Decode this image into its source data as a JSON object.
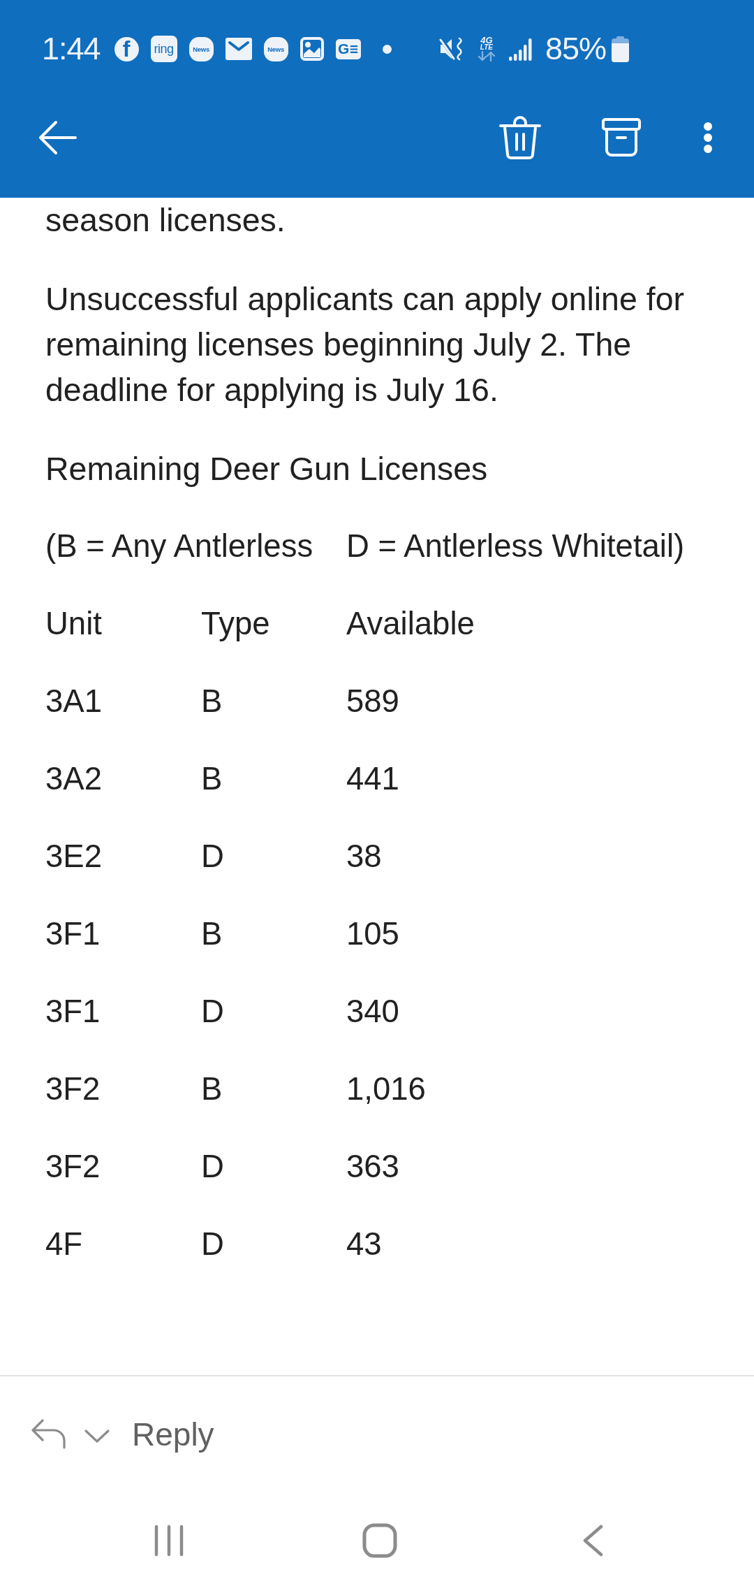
{
  "status_bar": {
    "time": "1:44",
    "notifications": [
      {
        "kind": "disc",
        "label": "f"
      },
      {
        "kind": "tile",
        "label": "ring"
      },
      {
        "kind": "squircle",
        "label": "News"
      },
      {
        "kind": "envelope"
      },
      {
        "kind": "squircle",
        "label": "News"
      },
      {
        "kind": "picture"
      },
      {
        "kind": "lines",
        "label": "G"
      },
      {
        "kind": "dot"
      }
    ],
    "network": {
      "generation": "4G",
      "technology": "LTE"
    },
    "battery": "85%"
  },
  "message": {
    "paragraphs": [
      "season licenses.",
      "Unsuccessful applicants can apply online for remaining licenses beginning July 2. The deadline for applying is July 16.",
      "Remaining Deer Gun Licenses"
    ],
    "legend": [
      "(B = Any Antlerless",
      "D = Antlerless Whitetail)"
    ],
    "table": {
      "columns": [
        "Unit",
        "Type",
        "Available"
      ],
      "rows": [
        [
          "3A1",
          "B",
          "589"
        ],
        [
          "3A2",
          "B",
          "441"
        ],
        [
          "3E2",
          "D",
          "38"
        ],
        [
          "3F1",
          "B",
          "105"
        ],
        [
          "3F1",
          "D",
          "340"
        ],
        [
          "3F2",
          "B",
          "1,016"
        ],
        [
          "3F2",
          "D",
          "363"
        ],
        [
          "4F",
          "D",
          "43"
        ]
      ]
    }
  },
  "reply_bar": {
    "label": "Reply"
  }
}
